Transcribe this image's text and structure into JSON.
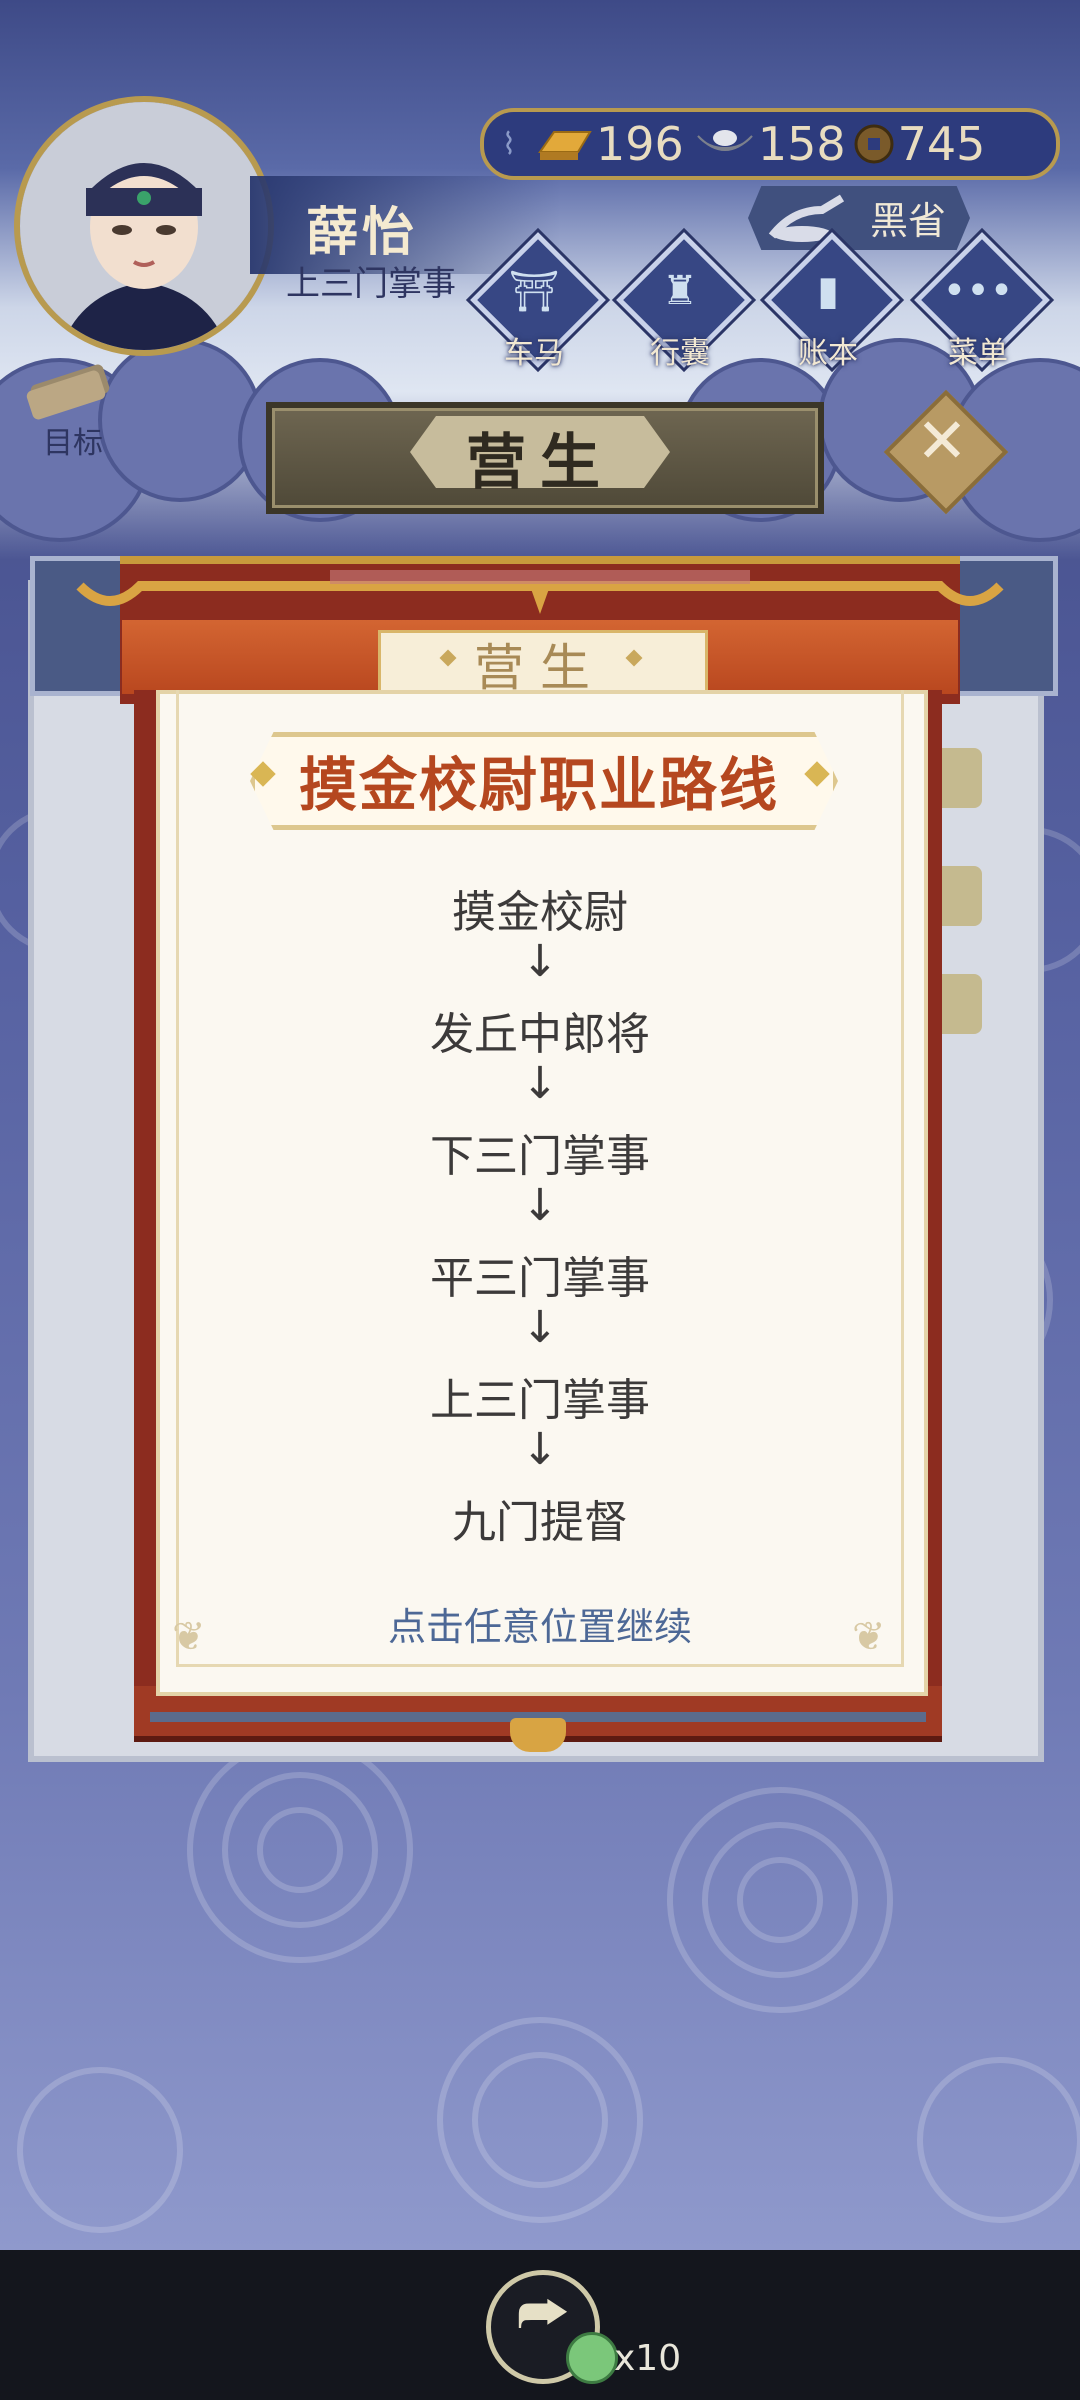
{
  "player": {
    "name": "薛怡",
    "title": "上三门掌事"
  },
  "currency": {
    "gold": "196",
    "silver": "158",
    "coins": "745"
  },
  "region": {
    "label": "黑省"
  },
  "menu": [
    {
      "label": "车马",
      "icon": "carriage-icon"
    },
    {
      "label": "行囊",
      "icon": "bag-icon"
    },
    {
      "label": "账本",
      "icon": "ledger-icon"
    },
    {
      "label": "菜单",
      "icon": "menu-dots-icon"
    }
  ],
  "goal": {
    "label": "目标"
  },
  "header": {
    "title": "营生"
  },
  "dialog": {
    "tab": "营生",
    "route_title": "摸金校尉职业路线",
    "careers": [
      "摸金校尉",
      "发丘中郎将",
      "下三门掌事",
      "平三门掌事",
      "上三门掌事",
      "九门提督"
    ],
    "arrow": "↓",
    "continue_hint": "点击任意位置继续"
  },
  "bottom": {
    "reward_count": "x10"
  },
  "colors": {
    "frame_red": "#8c2c1f",
    "title_orange": "#b5471f",
    "paper": "#fbf8f1",
    "hint_blue": "#4d6896"
  }
}
